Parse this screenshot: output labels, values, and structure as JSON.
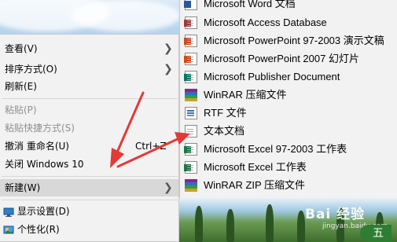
{
  "context_menu": {
    "items": [
      {
        "label": "查看(V)",
        "has_submenu": true,
        "disabled": false
      },
      {
        "label": "排序方式(O)",
        "has_submenu": true,
        "disabled": false
      },
      {
        "label": "刷新(E)",
        "has_submenu": false,
        "disabled": false
      },
      {
        "label": "粘贴(P)",
        "has_submenu": false,
        "disabled": true
      },
      {
        "label": "粘贴快捷方式(S)",
        "has_submenu": false,
        "disabled": true
      },
      {
        "label": "撤消 重命名(U)",
        "shortcut": "Ctrl+Z",
        "disabled": false
      },
      {
        "label": "关闭 Windows 10",
        "disabled": false
      },
      {
        "label": "新建(W)",
        "has_submenu": true,
        "highlighted": true
      },
      {
        "label": "显示设置(D)",
        "icon": "display-icon"
      },
      {
        "label": "个性化(R)",
        "icon": "personalize-icon"
      }
    ]
  },
  "new_submenu": {
    "items": [
      {
        "label": "Microsoft Word 文档",
        "icon": "word-icon"
      },
      {
        "label": "Microsoft Access Database",
        "icon": "access-icon"
      },
      {
        "label": "Microsoft PowerPoint 97-2003 演示文稿",
        "icon": "powerpoint-icon"
      },
      {
        "label": "Microsoft PowerPoint 2007 幻灯片",
        "icon": "powerpoint-icon"
      },
      {
        "label": "Microsoft Publisher Document",
        "icon": "publisher-icon"
      },
      {
        "label": "WinRAR 压缩文件",
        "icon": "winrar-icon"
      },
      {
        "label": "RTF 文件",
        "icon": "rtf-icon"
      },
      {
        "label": "文本文档",
        "icon": "text-document-icon"
      },
      {
        "label": "Microsoft Excel 97-2003 工作表",
        "icon": "excel-icon"
      },
      {
        "label": "Microsoft Excel 工作表",
        "icon": "excel-icon"
      },
      {
        "label": "WinRAR ZIP 压缩文件",
        "icon": "winrar-icon"
      }
    ]
  },
  "colors": {
    "arrow": "#e53935",
    "menu_bg": "#f2f2f2",
    "highlight": "#d8d8d8"
  },
  "watermark": {
    "brand": "Bai 经验",
    "url": "jingyan.baidu.com"
  },
  "corner_button": {
    "label": "五"
  }
}
